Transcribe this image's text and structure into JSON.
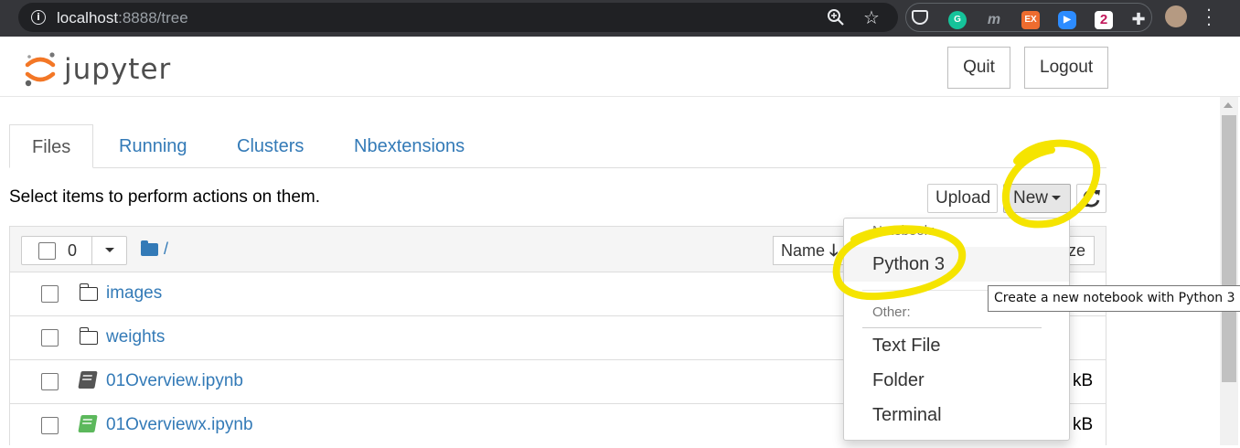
{
  "browser": {
    "url_host": "localhost",
    "url_rest": ":8888/tree"
  },
  "header": {
    "logo_text": "jupyter",
    "quit_label": "Quit",
    "logout_label": "Logout"
  },
  "tabs": [
    {
      "label": "Files",
      "active": true
    },
    {
      "label": "Running",
      "active": false
    },
    {
      "label": "Clusters",
      "active": false
    },
    {
      "label": "Nbextensions",
      "active": false
    }
  ],
  "toolbar": {
    "instructions": "Select items to perform actions on them.",
    "upload_label": "Upload",
    "new_label": "New"
  },
  "list_header": {
    "selected_count": "0",
    "breadcrumb": "/",
    "name_sort_label": "Name",
    "size_label_partial": "ze"
  },
  "files": [
    {
      "name": "images",
      "type": "folder",
      "size": ""
    },
    {
      "name": "weights",
      "type": "folder",
      "size": ""
    },
    {
      "name": "01Overview.ipynb",
      "type": "notebook",
      "size": "kB",
      "icon_color": "#555555"
    },
    {
      "name": "01Overviewx.ipynb",
      "type": "notebook-running",
      "size": "kB",
      "icon_color": "#5cb85c"
    }
  ],
  "new_menu": {
    "notebook_header": "Notebook:",
    "python3": "Python 3",
    "other_header": "Other:",
    "text_file": "Text File",
    "folder": "Folder",
    "terminal": "Terminal"
  },
  "tooltip": "Create a new notebook with Python 3",
  "colors": {
    "link": "#337ab7",
    "highlighter": "#f5e400",
    "jupyter_orange": "#f37726"
  }
}
